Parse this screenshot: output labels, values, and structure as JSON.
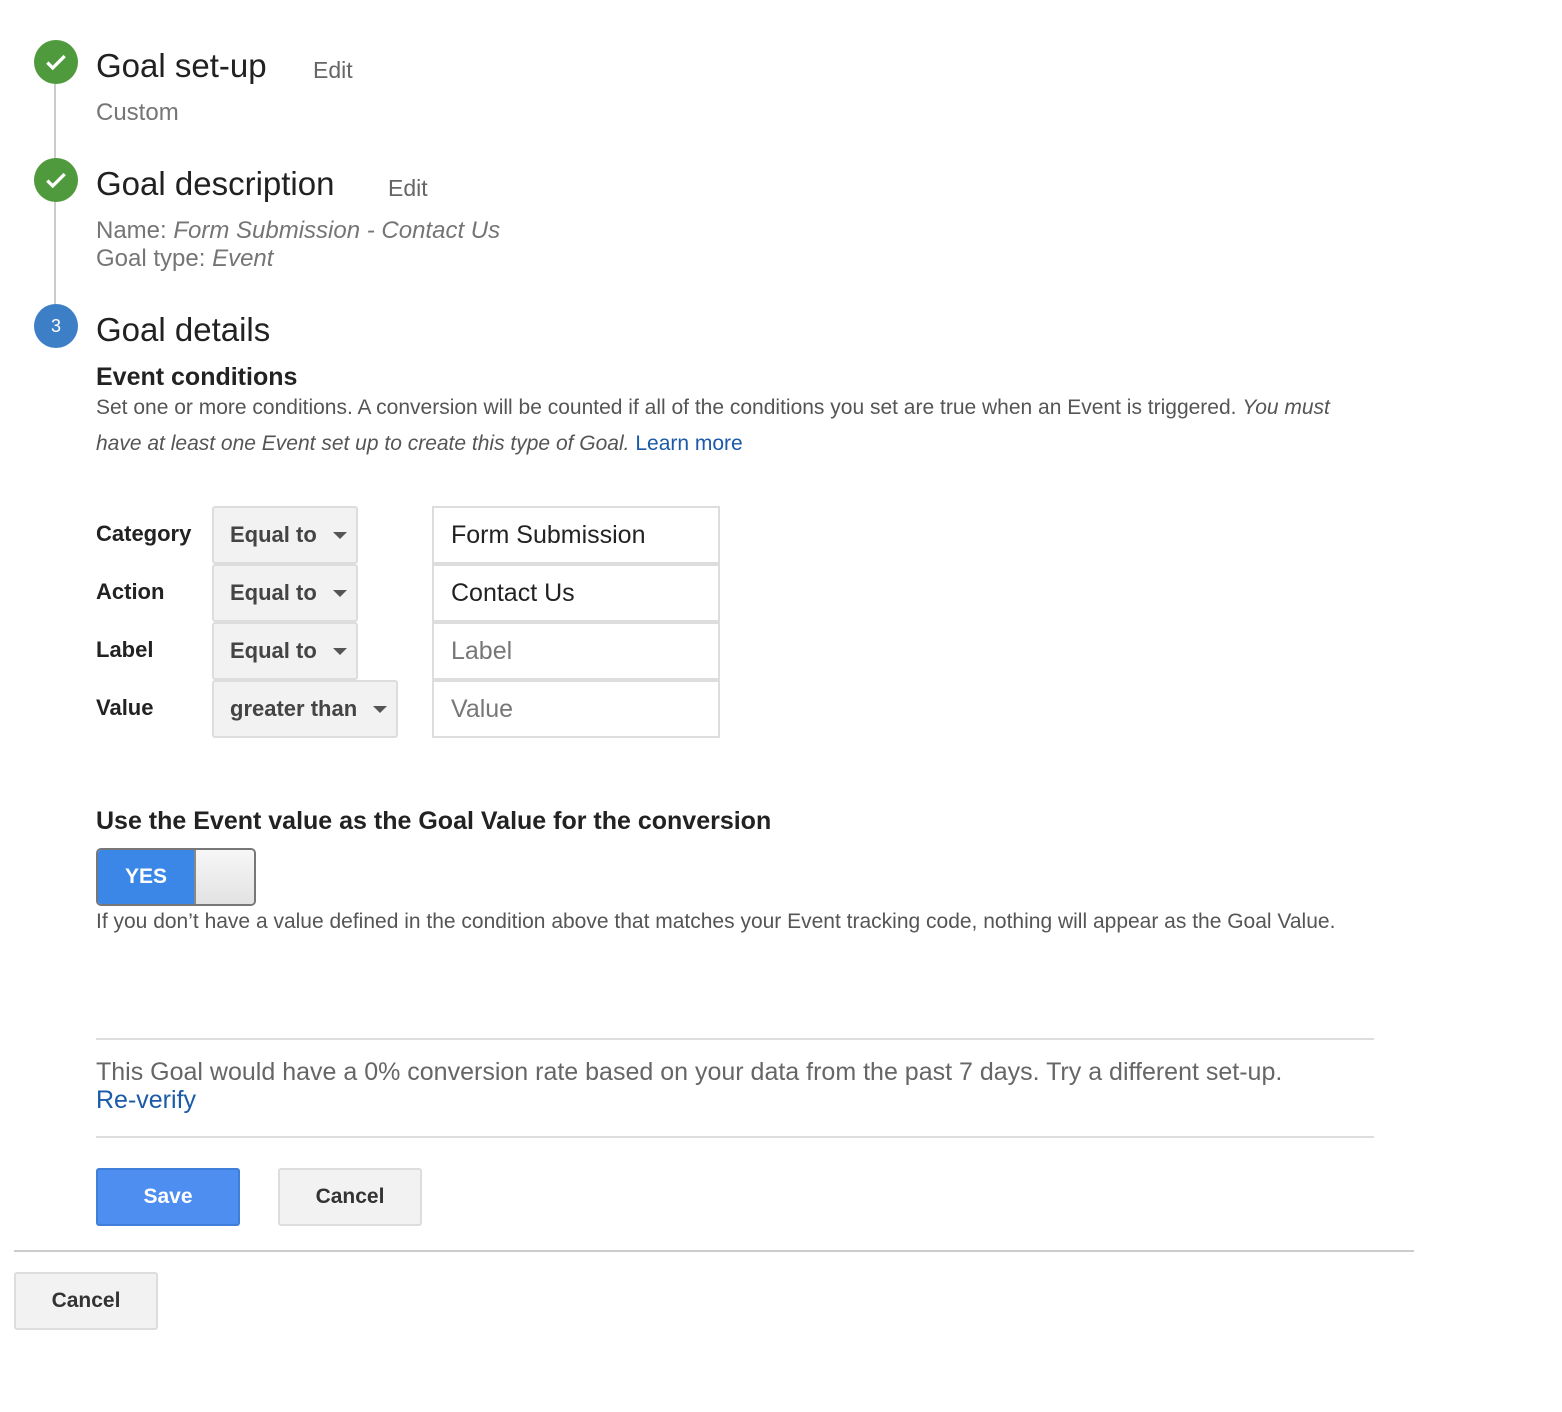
{
  "steps": [
    {
      "number": "1",
      "status": "complete",
      "icon": "check-icon",
      "title": "Goal set-up",
      "edit_label": "Edit",
      "summary": "Custom"
    },
    {
      "number": "2",
      "status": "complete",
      "icon": "check-icon",
      "title": "Goal description",
      "edit_label": "Edit",
      "name_label": "Name:",
      "name_value": "Form Submission - Contact Us",
      "type_label": "Goal type:",
      "type_value": "Event"
    },
    {
      "number": "3",
      "status": "active",
      "title": "Goal details"
    }
  ],
  "event_conditions": {
    "heading": "Event conditions",
    "description": "Set one or more conditions. A conversion will be counted if all of the conditions you set are true when an Event is triggered.",
    "note": "You must have at least one Event set up to create this type of Goal.",
    "learn_more": "Learn more",
    "rows": [
      {
        "label": "Category",
        "operator": "Equal to",
        "value": "Form Submission",
        "placeholder": ""
      },
      {
        "label": "Action",
        "operator": "Equal to",
        "value": "Contact Us",
        "placeholder": ""
      },
      {
        "label": "Label",
        "operator": "Equal to",
        "value": "",
        "placeholder": "Label"
      },
      {
        "label": "Value",
        "operator": "greater than",
        "value": "",
        "placeholder": "Value"
      }
    ]
  },
  "goal_value": {
    "heading": "Use the Event value as the Goal Value for the conversion",
    "toggle_label": "YES",
    "toggle_on": true,
    "help": "If you don’t have a value defined in the condition above that matches your Event tracking code, nothing will appear as the Goal Value."
  },
  "verify": {
    "message": "This Goal would have a 0% conversion rate based on your data from the past 7 days. Try a different set-up.",
    "link": "Re-verify"
  },
  "actions": {
    "save": "Save",
    "cancel": "Cancel",
    "outer_cancel": "Cancel"
  },
  "colors": {
    "complete": "#4f9a3c",
    "active": "#3d7fc7",
    "primary": "#4d8ef0",
    "link": "#1a5aa8"
  }
}
